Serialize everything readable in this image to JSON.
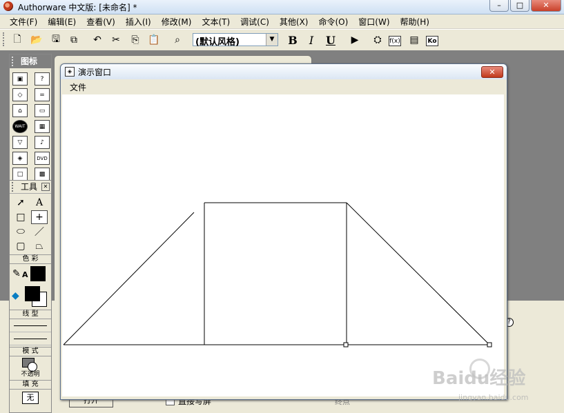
{
  "window": {
    "title": "Authorware 中文版: [未命名] *"
  },
  "menubar": {
    "items": [
      "文件(F)",
      "编辑(E)",
      "查看(V)",
      "插入(I)",
      "修改(M)",
      "文本(T)",
      "调试(C)",
      "其他(X)",
      "命令(O)",
      "窗口(W)",
      "帮助(H)"
    ]
  },
  "toolbar": {
    "style_value": "(默认风格)",
    "bold_label": "B",
    "italic_label": "I",
    "underline_label": "U",
    "func_label": "f(x)",
    "ko_label": "Ko"
  },
  "icon_palette": {
    "title": "图标",
    "icons": [
      "display-icon",
      "interaction-icon",
      "erase-icon",
      "calculation-icon",
      "motion-icon",
      "map-icon",
      "wait-icon",
      "movie-icon",
      "decision-icon",
      "sound-icon",
      "navigate-icon",
      "dvd-icon",
      "framework-icon"
    ]
  },
  "tools_palette": {
    "title": "工具",
    "color_label": "色 彩",
    "line_label": "线 型",
    "mode_label": "模 式",
    "mode_value": "不透明",
    "fill_label": "填 充",
    "fill_value": "无"
  },
  "presentation": {
    "title": "演示窗口",
    "menu_file": "文件"
  },
  "background": {
    "open_button": "打开",
    "checkbox_label": "直接写屏",
    "end_label": "终点"
  },
  "watermark": {
    "brand": "Baidu经验",
    "url": "jingyan.baidu.com"
  },
  "colors": {
    "titlebar": "#dbe6f3",
    "close": "#c0391c",
    "face": "#ece9d8"
  }
}
